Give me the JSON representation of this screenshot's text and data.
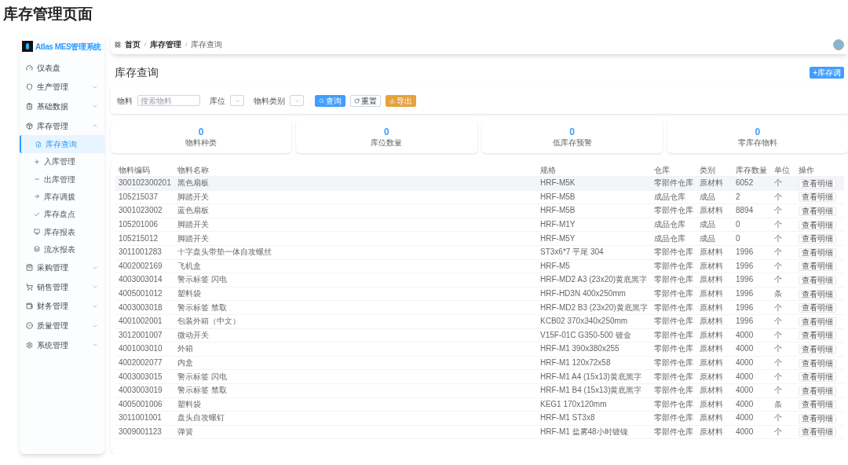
{
  "page_title": "库存管理页面",
  "app": {
    "name": "Atlas MES管理系统"
  },
  "sidebar": {
    "items": [
      {
        "label": "仪表盘"
      },
      {
        "label": "生产管理",
        "expanded": false
      },
      {
        "label": "基础数据",
        "expanded": false
      },
      {
        "label": "库存管理",
        "expanded": true,
        "children": [
          {
            "label": "库存查询",
            "selected": true
          },
          {
            "label": "入库管理",
            "selected": false
          },
          {
            "label": "出库管理",
            "selected": false
          },
          {
            "label": "库存调拨",
            "selected": false
          },
          {
            "label": "库存盘点",
            "selected": false
          },
          {
            "label": "库存报表",
            "selected": false
          },
          {
            "label": "流水报表",
            "selected": false
          }
        ]
      },
      {
        "label": "采购管理",
        "expanded": false
      },
      {
        "label": "销售管理",
        "expanded": false
      },
      {
        "label": "财务管理",
        "expanded": false
      },
      {
        "label": "质量管理",
        "expanded": false
      },
      {
        "label": "系统管理",
        "expanded": false
      }
    ]
  },
  "breadcrumb": [
    "首页",
    "库存管理",
    "库存查询"
  ],
  "breadcrumb_separator": "/",
  "content_title": "库存查询",
  "primary_action": "+库存调",
  "filters": {
    "material_label": "物料",
    "material_placeholder": "搜索物料",
    "location_label": "库位",
    "category_label": "物料类别",
    "buttons": [
      {
        "label": "查询",
        "kind": "primary"
      },
      {
        "label": "重置",
        "kind": "reset"
      },
      {
        "label": "导出",
        "kind": "export"
      }
    ]
  },
  "stats": [
    {
      "value": "0",
      "label": "物料种类"
    },
    {
      "value": "0",
      "label": "库位数量"
    },
    {
      "value": "0",
      "label": "低库存预警"
    },
    {
      "value": "0",
      "label": "零库存物料"
    }
  ],
  "table": {
    "columns": [
      "物料编码",
      "物料名称",
      "规格",
      "仓库",
      "类别",
      "库存数量",
      "单位",
      "操作"
    ],
    "rows": [
      {
        "selected": true,
        "cells": [
          "300102300201",
          "黑色扇板",
          "HRF-M5K",
          "零部件仓库",
          "原材料",
          "6052",
          "个"
        ],
        "action": "查看明细"
      },
      {
        "selected": false,
        "cells": [
          "105215037",
          "脚踏开关",
          "HRF-M5B",
          "成品仓库",
          "成品",
          "2",
          "个"
        ],
        "action": "查看明细"
      },
      {
        "selected": false,
        "cells": [
          "3001023002",
          "蓝色扇板",
          "HRF-M5B",
          "零部件仓库",
          "原材料",
          "8894",
          "个"
        ],
        "action": "查看明细"
      },
      {
        "selected": false,
        "cells": [
          "105201006",
          "脚踏开关",
          "HRF-M1Y",
          "成品仓库",
          "成品",
          "0",
          "个"
        ],
        "action": "查看明细"
      },
      {
        "selected": false,
        "cells": [
          "105215012",
          "脚踏开关",
          "HRF-M5Y",
          "成品仓库",
          "成品",
          "0",
          "个"
        ],
        "action": "查看明细"
      },
      {
        "selected": false,
        "cells": [
          "3011001283",
          "十字盘头带垫一体自攻螺丝",
          "ST3x6*7 平尾 304",
          "零部件仓库",
          "原材料",
          "1996",
          "个"
        ],
        "action": "查看明细"
      },
      {
        "selected": false,
        "cells": [
          "4002002169",
          "飞机盒",
          "HRF-M5",
          "零部件仓库",
          "原材料",
          "1996",
          "个"
        ],
        "action": "查看明细"
      },
      {
        "selected": false,
        "cells": [
          "4003003014",
          "警示标签 闪电",
          "HRF-MD2 A3 (23x20)黄底黑字",
          "零部件仓库",
          "原材料",
          "1996",
          "个"
        ],
        "action": "查看明细"
      },
      {
        "selected": false,
        "cells": [
          "4005001012",
          "塑料袋",
          "HRF-HD3N 400x250mm",
          "零部件仓库",
          "原材料",
          "1996",
          "条"
        ],
        "action": "查看明细"
      },
      {
        "selected": false,
        "cells": [
          "4003003018",
          "警示标签 禁取",
          "HRF-MD2 B3 (23x20)黄底黑字",
          "零部件仓库",
          "原材料",
          "1996",
          "个"
        ],
        "action": "查看明细"
      },
      {
        "selected": false,
        "cells": [
          "4001002001",
          "包装外箱（中文）",
          "KCB02 370x340x250mm",
          "零部件仓库",
          "原材料",
          "1996",
          "个"
        ],
        "action": "查看明细"
      },
      {
        "selected": false,
        "cells": [
          "3012001007",
          "微动开关",
          "V15F-01C G350-500 镀金",
          "零部件仓库",
          "原材料",
          "4000",
          "个"
        ],
        "action": "查看明细"
      },
      {
        "selected": false,
        "cells": [
          "4001003010",
          "外箱",
          "HRF-M1 390x380x255",
          "零部件仓库",
          "原材料",
          "4000",
          "个"
        ],
        "action": "查看明细"
      },
      {
        "selected": false,
        "cells": [
          "4002002077",
          "内盒",
          "HRF-M1 120x72x58",
          "零部件仓库",
          "原材料",
          "4000",
          "个"
        ],
        "action": "查看明细"
      },
      {
        "selected": false,
        "cells": [
          "4003003015",
          "警示标签 闪电",
          "HRF-M1 A4 (15x13)黄底黑字",
          "零部件仓库",
          "原材料",
          "4000",
          "个"
        ],
        "action": "查看明细"
      },
      {
        "selected": false,
        "cells": [
          "4003003019",
          "警示标签 禁取",
          "HRF-M1 B4 (15x13)黄底黑字",
          "零部件仓库",
          "原材料",
          "4000",
          "个"
        ],
        "action": "查看明细"
      },
      {
        "selected": false,
        "cells": [
          "4005001006",
          "塑料袋",
          "KEG1 170x120mm",
          "零部件仓库",
          "原材料",
          "4000",
          "条"
        ],
        "action": "查看明细"
      },
      {
        "selected": false,
        "cells": [
          "3011001001",
          "盘头自攻螺钉",
          "HRF-M1 ST3x8",
          "零部件仓库",
          "原材料",
          "4000",
          "个"
        ],
        "action": "查看明细"
      },
      {
        "selected": false,
        "cells": [
          "3009001123",
          "弹簧",
          "HRF-M1 盐雾48小时镀镍",
          "零部件仓库",
          "原材料",
          "4000",
          "个"
        ],
        "action": "查看明细"
      }
    ]
  }
}
